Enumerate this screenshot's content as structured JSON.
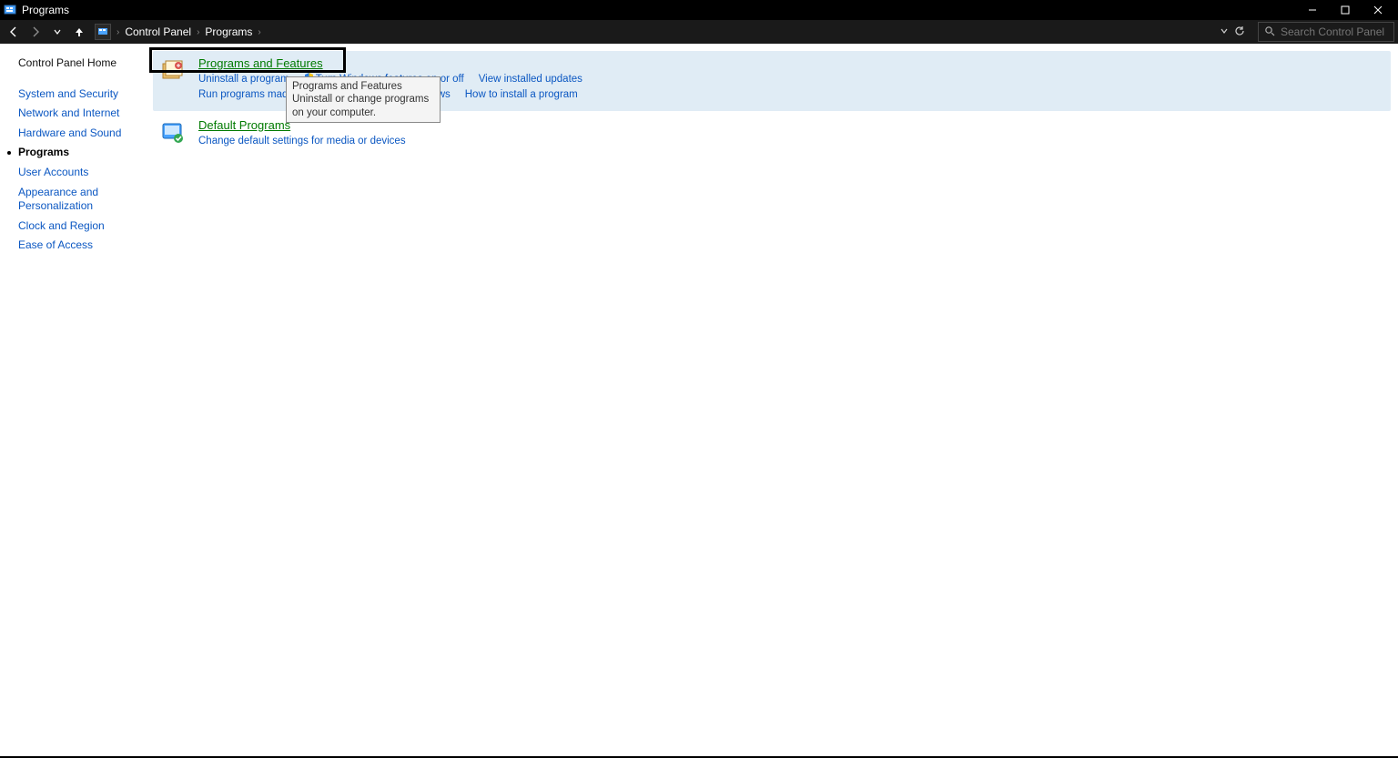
{
  "window": {
    "title": "Programs"
  },
  "breadcrumb": {
    "root": "Control Panel",
    "current": "Programs"
  },
  "search": {
    "placeholder": "Search Control Panel"
  },
  "sidebar": {
    "home": "Control Panel Home",
    "items": [
      "System and Security",
      "Network and Internet",
      "Hardware and Sound",
      "Programs",
      "User Accounts",
      "Appearance and Personalization",
      "Clock and Region",
      "Ease of Access"
    ],
    "active_index": 3
  },
  "categories": [
    {
      "title": "Programs and Features",
      "links": [
        {
          "label": "Uninstall a program",
          "shield": false
        },
        {
          "label": "Turn Windows features on or off",
          "shield": true
        },
        {
          "label": "View installed updates",
          "shield": false
        },
        {
          "label": "Run programs made for previous versions of Windows",
          "shield": false
        },
        {
          "label": "How to install a program",
          "shield": false
        }
      ]
    },
    {
      "title": "Default Programs",
      "links": [
        {
          "label": "Change default settings for media or devices",
          "shield": false
        }
      ]
    }
  ],
  "tooltip": {
    "title": "Programs and Features",
    "body": "Uninstall or change programs on your computer."
  }
}
